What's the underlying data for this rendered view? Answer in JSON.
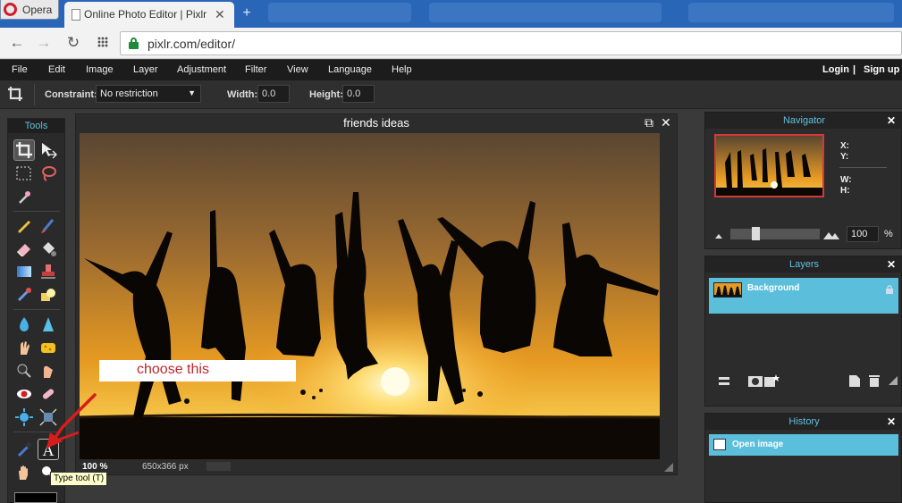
{
  "browser": {
    "opera_label": "Opera",
    "tab_title": "Online Photo Editor | Pixlr",
    "url": "pixlr.com/editor/"
  },
  "menu": {
    "items": [
      "File",
      "Edit",
      "Image",
      "Layer",
      "Adjustment",
      "Filter",
      "View",
      "Language",
      "Help"
    ],
    "login": "Login",
    "separator": "|",
    "signup": "Sign up"
  },
  "options": {
    "constraint_label": "Constraint:",
    "constraint_value": "No restriction",
    "width_label": "Width:",
    "width_value": "0.0",
    "height_label": "Height:",
    "height_value": "0.0"
  },
  "tools": {
    "title": "Tools",
    "tooltip": "Type tool (T)"
  },
  "canvas": {
    "title": "friends ideas",
    "zoom": "100 %",
    "size": "650x366 px"
  },
  "annotation": {
    "callout": "choose this"
  },
  "navigator": {
    "title": "Navigator",
    "x_label": "X:",
    "y_label": "Y:",
    "w_label": "W:",
    "h_label": "H:",
    "zoom_value": "100",
    "zoom_unit": "%"
  },
  "layers": {
    "title": "Layers",
    "items": [
      {
        "name": "Background",
        "locked": true
      }
    ]
  },
  "history": {
    "title": "History",
    "items": [
      {
        "label": "Open image"
      }
    ]
  },
  "colors": {
    "accent": "#5bbfdb",
    "panel_title": "#5fc0e0",
    "annotation_red": "#c0262b",
    "menubar": "#1c1c1c"
  }
}
